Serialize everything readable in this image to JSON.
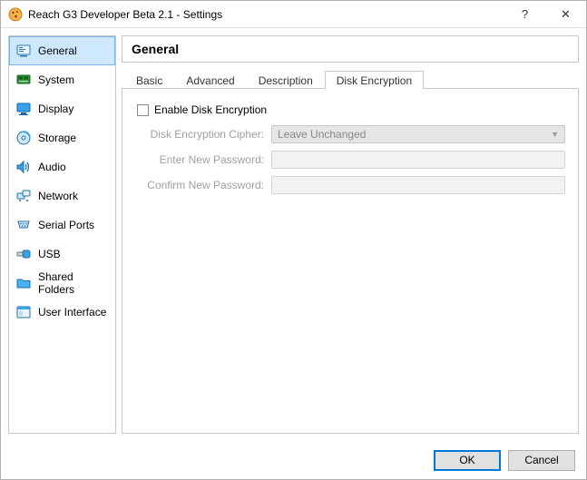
{
  "window": {
    "title": "Reach G3 Developer Beta 2.1 - Settings"
  },
  "sidebar": {
    "items": [
      {
        "label": "General",
        "icon": "general",
        "selected": true
      },
      {
        "label": "System",
        "icon": "system",
        "selected": false
      },
      {
        "label": "Display",
        "icon": "display",
        "selected": false
      },
      {
        "label": "Storage",
        "icon": "storage",
        "selected": false
      },
      {
        "label": "Audio",
        "icon": "audio",
        "selected": false
      },
      {
        "label": "Network",
        "icon": "network",
        "selected": false
      },
      {
        "label": "Serial Ports",
        "icon": "serial",
        "selected": false
      },
      {
        "label": "USB",
        "icon": "usb",
        "selected": false
      },
      {
        "label": "Shared Folders",
        "icon": "folder",
        "selected": false
      },
      {
        "label": "User Interface",
        "icon": "ui",
        "selected": false
      }
    ]
  },
  "main": {
    "header": "General",
    "tabs": [
      {
        "label": "Basic",
        "active": false
      },
      {
        "label": "Advanced",
        "active": false
      },
      {
        "label": "Description",
        "active": false
      },
      {
        "label": "Disk Encryption",
        "active": true
      }
    ],
    "enable_label": "Enable Disk Encryption",
    "enable_checked": false,
    "cipher_label": "Disk Encryption Cipher:",
    "cipher_value": "Leave Unchanged",
    "newpw_label": "Enter New Password:",
    "confirmpw_label": "Confirm New Password:"
  },
  "buttons": {
    "ok": "OK",
    "cancel": "Cancel",
    "help": "?",
    "close": "✕"
  }
}
